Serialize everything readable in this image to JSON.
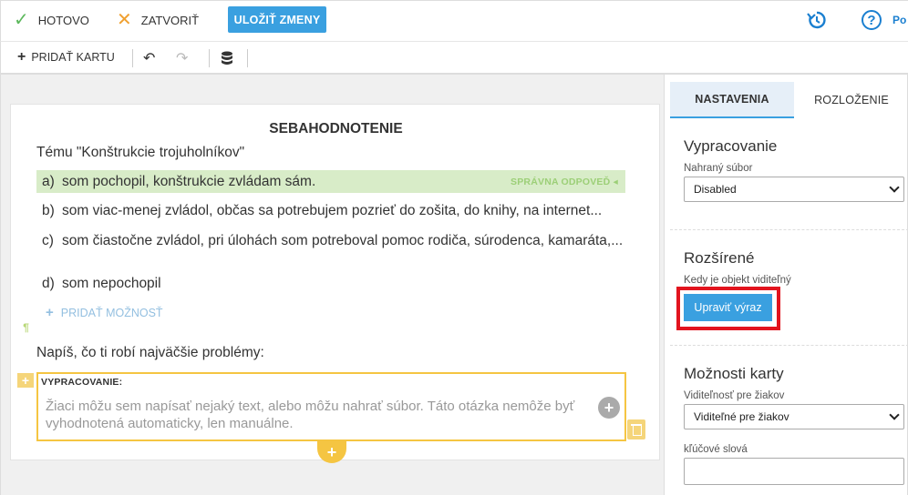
{
  "topbar": {
    "done_label": "HOTOVO",
    "close_label": "ZATVORIŤ",
    "save_label": "ULOŽIŤ ZMENY",
    "help_label": "Po"
  },
  "toolbar": {
    "add_card_label": "PRIDAŤ KARTU"
  },
  "card": {
    "title": "SEBAHODNOTENIE",
    "question": "Tému \"Konštrukcie trojuholníkov\"",
    "options": [
      {
        "label": "a)",
        "text": "som pochopil, konštrukcie zvládam sám."
      },
      {
        "label": "b)",
        "text": "som viac-menej zvládol, občas sa potrebujem pozrieť do zošita, do knihy, na internet..."
      },
      {
        "label": "c)",
        "text": "som čiastočne zvládol, pri úlohách som potreboval pomoc rodiča, súrodenca, kamaráta,..."
      },
      {
        "label": "d)",
        "text": "som nepochopil"
      }
    ],
    "correct_tag": "SPRÁVNA ODPOVEĎ",
    "add_option_label": "PRIDAŤ MOŽNOSŤ",
    "fmt_mark": "¶",
    "prompt2": "Napíš, čo ti robí najväčšie problémy:",
    "answer_label": "VYPRACOVANIE:",
    "answer_text": "Žiaci môžu sem napísať nejaký text, alebo môžu nahrať súbor. Táto otázka nemôže byť vyhodnotená automaticky, len manuálne."
  },
  "panel": {
    "tab_settings": "NASTAVENIA",
    "tab_layout": "ROZLOŽENIE",
    "section1_title": "Vypracovanie",
    "section1_label": "Nahraný súbor",
    "section1_value": "Disabled",
    "section2_title": "Rozšírené",
    "section2_label": "Kedy je objekt viditeľný",
    "edit_button": "Upraviť výraz",
    "section3_title": "Možnosti karty",
    "visibility_label": "Viditeľnosť pre žiakov",
    "visibility_value": "Viditeľné pre žiakov",
    "keywords_label": "kľúčové slová"
  },
  "colors": {
    "accent": "#3aa0e0",
    "correct_bg": "#d8ecc8",
    "highlight": "#f5c542",
    "red_frame": "#e2141e"
  }
}
